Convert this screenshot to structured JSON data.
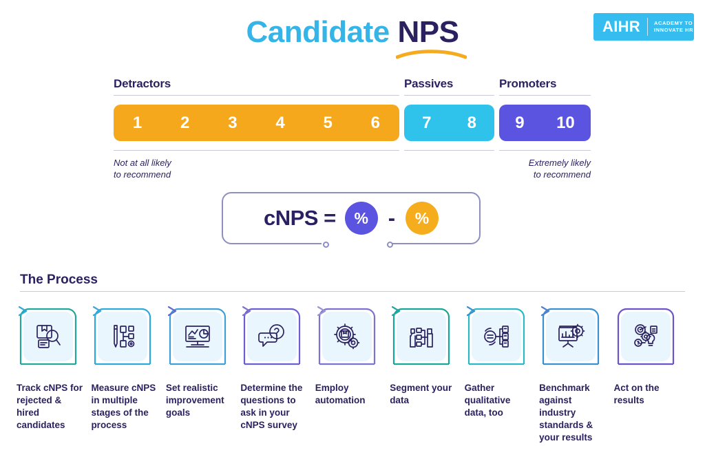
{
  "header": {
    "title_part1": "Candidate",
    "title_part2": "NPS",
    "logo_name": "AIHR",
    "logo_tagline_line1": "ACADEMY TO",
    "logo_tagline_line2": "INNOVATE HR",
    "logo_bg": "#35bdf0",
    "title_color_light": "#35b4e8",
    "title_color_dark": "#2b2160",
    "underline_color": "#f5ab1d"
  },
  "scale": {
    "groups": [
      {
        "label": "Detractors",
        "values": [
          "1",
          "2",
          "3",
          "4",
          "5",
          "6"
        ],
        "color": "#f5a81c"
      },
      {
        "label": "Passives",
        "values": [
          "7",
          "8"
        ],
        "color": "#2fc3ec"
      },
      {
        "label": "Promoters",
        "values": [
          "9",
          "10"
        ],
        "color": "#5a54e0"
      }
    ],
    "hint_left_line1": "Not at all likely",
    "hint_left_line2": "to recommend",
    "hint_right_line1": "Extremely likely",
    "hint_right_line2": "to recommend"
  },
  "formula": {
    "label": "cNPS =",
    "promoter_symbol": "%",
    "operator": "-",
    "detractor_symbol": "%",
    "promoter_color": "#5a54e0",
    "detractor_color": "#f5ad1d"
  },
  "process": {
    "heading": "The Process",
    "steps": [
      {
        "icon": "document-search-icon",
        "label": "Track cNPS for rejected & hired candidates",
        "outline": "#21a79a"
      },
      {
        "icon": "pencil-workflow-icon",
        "label": "Measure cNPS in multiple stages of the process",
        "outline": "#2ba9d8"
      },
      {
        "icon": "presentation-chart-icon",
        "label": "Set realistic improvement goals",
        "outline": "#3e9fd6"
      },
      {
        "icon": "question-chat-icon",
        "label": "Determine the questions to ask in your cNPS survey",
        "outline": "#6a5fd0"
      },
      {
        "icon": "gears-box-icon",
        "label": "Employ automation",
        "outline": "#7b72cf"
      },
      {
        "icon": "segmentation-flow-icon",
        "label": "Segment your data",
        "outline": "#16a596"
      },
      {
        "icon": "documents-network-icon",
        "label": "Gather qualitative data, too",
        "outline": "#2bb6c8"
      },
      {
        "icon": "benchmark-board-icon",
        "label": "Benchmark against industry standards & your results",
        "outline": "#3a8fd0"
      },
      {
        "icon": "target-idea-network-icon",
        "label": "Act on the results",
        "outline": "#6b53c9"
      }
    ]
  }
}
